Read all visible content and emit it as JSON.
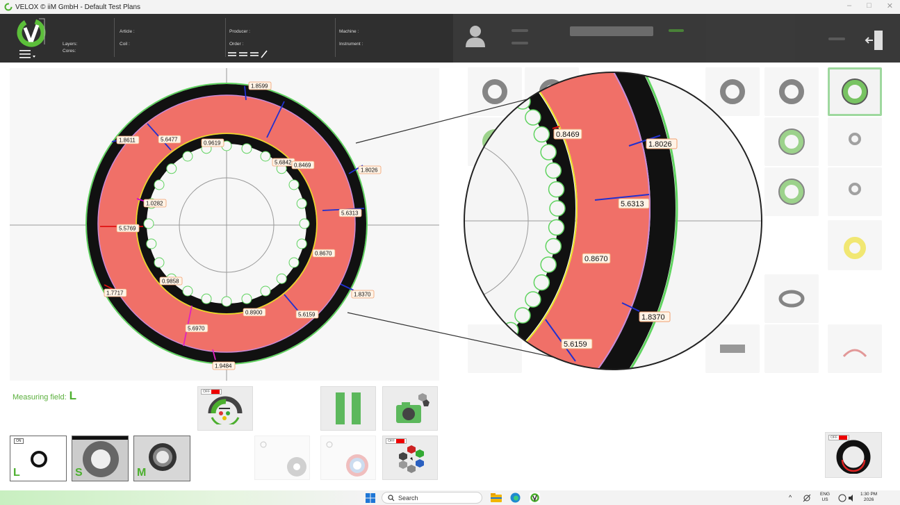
{
  "window": {
    "title": "VELOX © iiM GmbH - Default Test Plans",
    "controls": [
      "–",
      "□",
      "✕"
    ]
  },
  "header": {
    "layers_label": "Layers:",
    "cores_label": "Cores:",
    "article_label": "Article :",
    "coil_label": "Coil :",
    "producer_label": "Producer :",
    "order_label": "Order :",
    "machine_label": "Machine :",
    "instrument_label": "Instrument :"
  },
  "measurements": {
    "m1": "1.8599",
    "m2": "5.6842",
    "m3": "1.8611",
    "m4": "5.6477",
    "m5": "0.9619",
    "m6": "0.8469",
    "m7": "1.8026",
    "m8": "1.0282",
    "m9": "5.6313",
    "m10": "5.5769",
    "m11": "0.8670",
    "m12": "0.9858",
    "m13": "1.8370",
    "m14": "1.7717",
    "m15": "0.8900",
    "m16": "5.6159",
    "m17": "5.6970",
    "m18": "1.9484"
  },
  "zoom": {
    "z1": "0.8469",
    "z2": "1.8026",
    "z3": "5.6313",
    "z4": "0.8670",
    "z5": "1.8370",
    "z6": "5.6159"
  },
  "measuring_field": {
    "label": "Measuring field:",
    "value": "L"
  },
  "badges": {
    "off": "OFF",
    "on": "ON"
  },
  "thumbnails": [
    {
      "letter": "L"
    },
    {
      "letter": "S"
    },
    {
      "letter": "M"
    }
  ],
  "taskbar": {
    "search_placeholder": "Search",
    "lang_top": "ENG",
    "lang_bottom": "US",
    "time": "1:30 PM",
    "date": "2026"
  },
  "colors": {
    "accent_green": "#4caf2e",
    "ring_red": "#f07068",
    "dark": "#2f2f2f"
  }
}
